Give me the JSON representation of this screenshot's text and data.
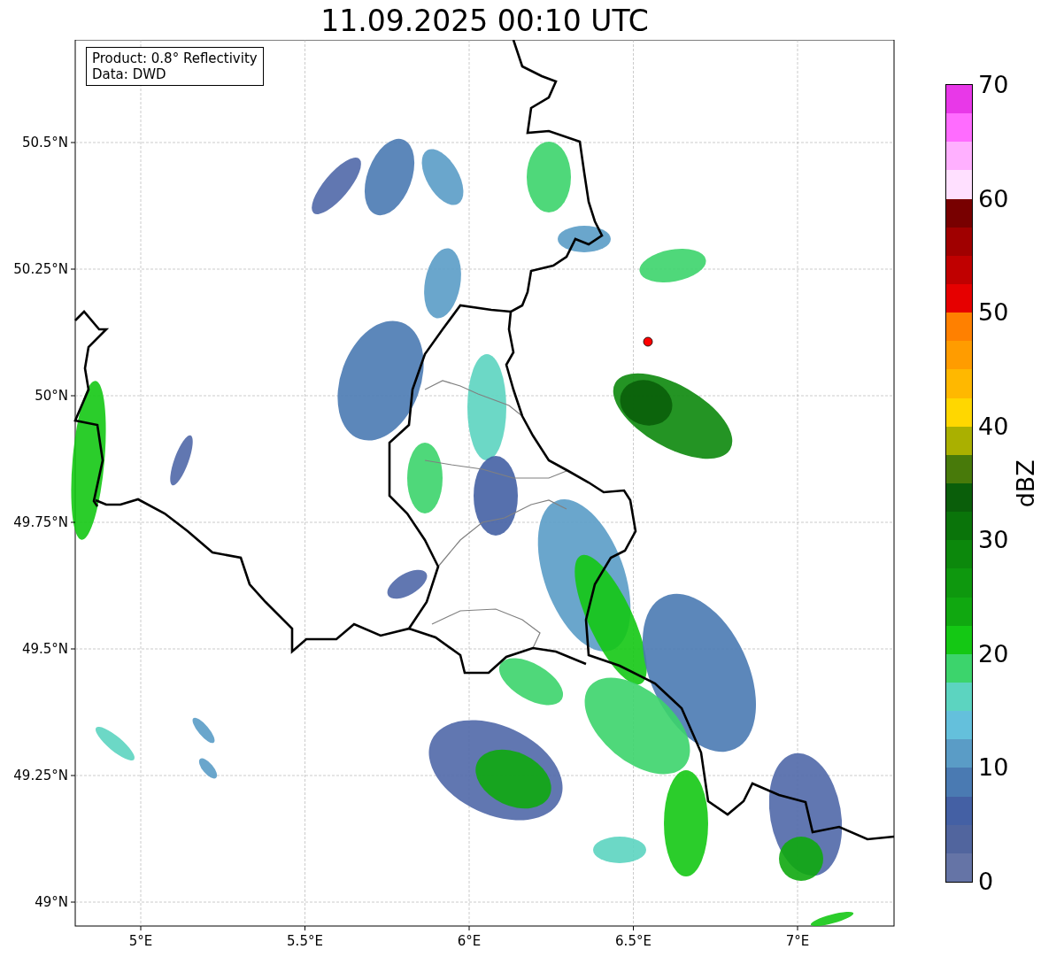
{
  "title": "11.09.2025 00:10 UTC",
  "info_box": {
    "lines": [
      "Product: 0.8° Reflectivity",
      "Data: DWD"
    ]
  },
  "map": {
    "yticks": [
      "50.5°N",
      "50.25°N",
      "50°N",
      "49.75°N",
      "49.5°N",
      "49.25°N",
      "49°N"
    ],
    "xticks": [
      "5°E",
      "5.5°E",
      "6°E",
      "6.5°E",
      "7°E"
    ]
  },
  "colorbar": {
    "label": "dBZ",
    "ticks": [
      "70",
      "60",
      "50",
      "40",
      "30",
      "20",
      "10",
      "0"
    ],
    "bins": [
      {
        "color": "#e838e8"
      },
      {
        "color": "#ff6cff"
      },
      {
        "color": "#ffb0ff"
      },
      {
        "color": "#ffe0ff"
      },
      {
        "color": "#780000"
      },
      {
        "color": "#a00000"
      },
      {
        "color": "#c00000"
      },
      {
        "color": "#e60000"
      },
      {
        "color": "#ff8000"
      },
      {
        "color": "#ff9c00"
      },
      {
        "color": "#ffb800"
      },
      {
        "color": "#ffd700"
      },
      {
        "color": "#aab000"
      },
      {
        "color": "#487a0a"
      },
      {
        "color": "#0a5e0a"
      },
      {
        "color": "#0a740a"
      },
      {
        "color": "#0c880c"
      },
      {
        "color": "#0e980e"
      },
      {
        "color": "#10a810"
      },
      {
        "color": "#14c814"
      },
      {
        "color": "#3cd46c"
      },
      {
        "color": "#5cd4c0"
      },
      {
        "color": "#64c0dc"
      },
      {
        "color": "#5a9cc6"
      },
      {
        "color": "#4a7ab2"
      },
      {
        "color": "#4460a4"
      },
      {
        "color": "#51659e"
      },
      {
        "color": "#6574a6"
      }
    ]
  }
}
